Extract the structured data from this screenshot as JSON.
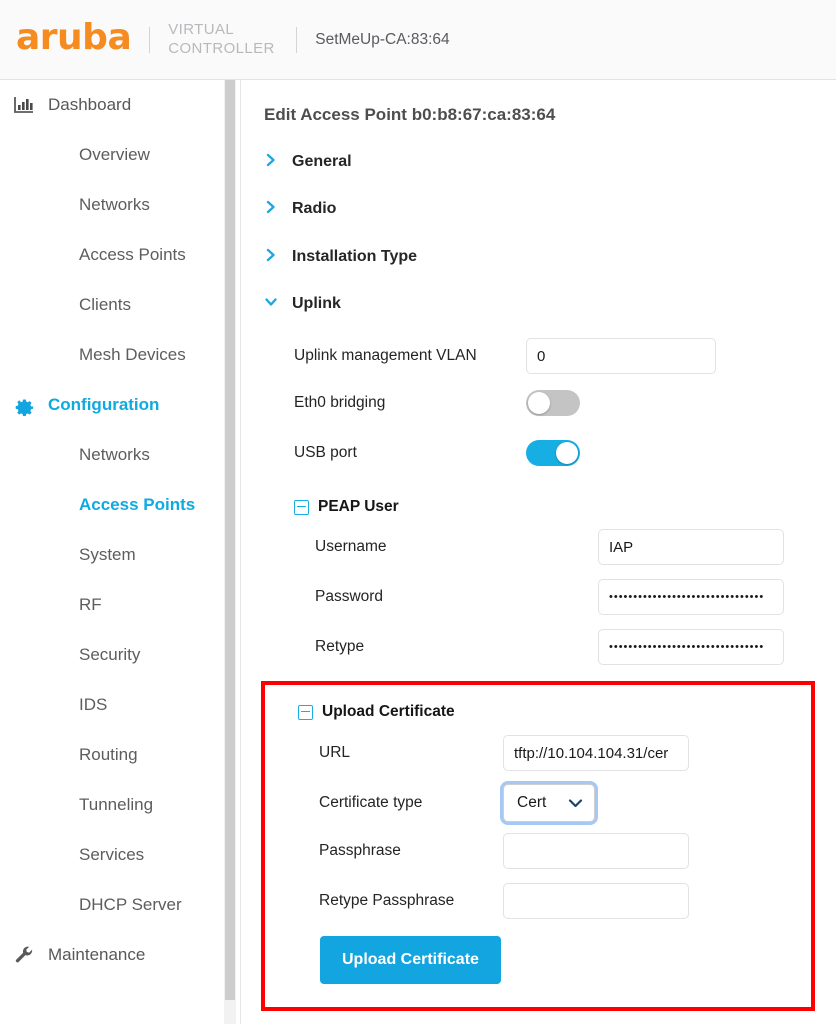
{
  "header": {
    "logo_text": "aruba",
    "virtual_controller_line1": "VIRTUAL",
    "virtual_controller_line2": "CONTROLLER",
    "device_name": "SetMeUp-CA:83:64",
    "logo_color": "#F68B1F"
  },
  "sidebar": {
    "groups": [
      {
        "label": "Dashboard",
        "icon": "bar-chart-icon",
        "active": false
      },
      {
        "label": "Configuration",
        "icon": "gear-icon",
        "active": true
      },
      {
        "label": "Maintenance",
        "icon": "wrench-icon",
        "active": false
      }
    ],
    "dashboard_items": [
      {
        "label": "Overview",
        "active": false
      },
      {
        "label": "Networks",
        "active": false
      },
      {
        "label": "Access Points",
        "active": false
      },
      {
        "label": "Clients",
        "active": false
      },
      {
        "label": "Mesh Devices",
        "active": false
      }
    ],
    "configuration_items": [
      {
        "label": "Networks",
        "active": false
      },
      {
        "label": "Access Points",
        "active": true
      },
      {
        "label": "System",
        "active": false
      },
      {
        "label": "RF",
        "active": false
      },
      {
        "label": "Security",
        "active": false
      },
      {
        "label": "IDS",
        "active": false
      },
      {
        "label": "Routing",
        "active": false
      },
      {
        "label": "Tunneling",
        "active": false
      },
      {
        "label": "Services",
        "active": false
      },
      {
        "label": "DHCP Server",
        "active": false
      }
    ],
    "accent_color": "#0faae0"
  },
  "main": {
    "page_title": "Edit Access Point b0:b8:67:ca:83:64",
    "sections": [
      {
        "label": "General",
        "expanded": false
      },
      {
        "label": "Radio",
        "expanded": false
      },
      {
        "label": "Installation Type",
        "expanded": false
      },
      {
        "label": "Uplink",
        "expanded": true
      }
    ],
    "uplink": {
      "vlan_label": "Uplink management VLAN",
      "vlan_value": "0",
      "eth0_label": "Eth0 bridging",
      "eth0_on": false,
      "usb_label": "USB port",
      "usb_on": true
    },
    "peap_user": {
      "title": "PEAP User",
      "username_label": "Username",
      "username_value": "IAP",
      "password_label": "Password",
      "password_value": "••••••••••••••••••••••••••••••••",
      "retype_label": "Retype",
      "retype_value": "••••••••••••••••••••••••••••••••"
    },
    "upload_certificate": {
      "title": "Upload Certificate",
      "url_label": "URL",
      "url_value": "tftp://10.104.104.31/cer",
      "cert_type_label": "Certificate type",
      "cert_type_value": "Cert",
      "passphrase_label": "Passphrase",
      "passphrase_value": "",
      "retype_passphrase_label": "Retype Passphrase",
      "retype_passphrase_value": "",
      "button_label": "Upload Certificate",
      "button_color": "#12A5E0",
      "highlight_color": "#FF0000"
    }
  }
}
